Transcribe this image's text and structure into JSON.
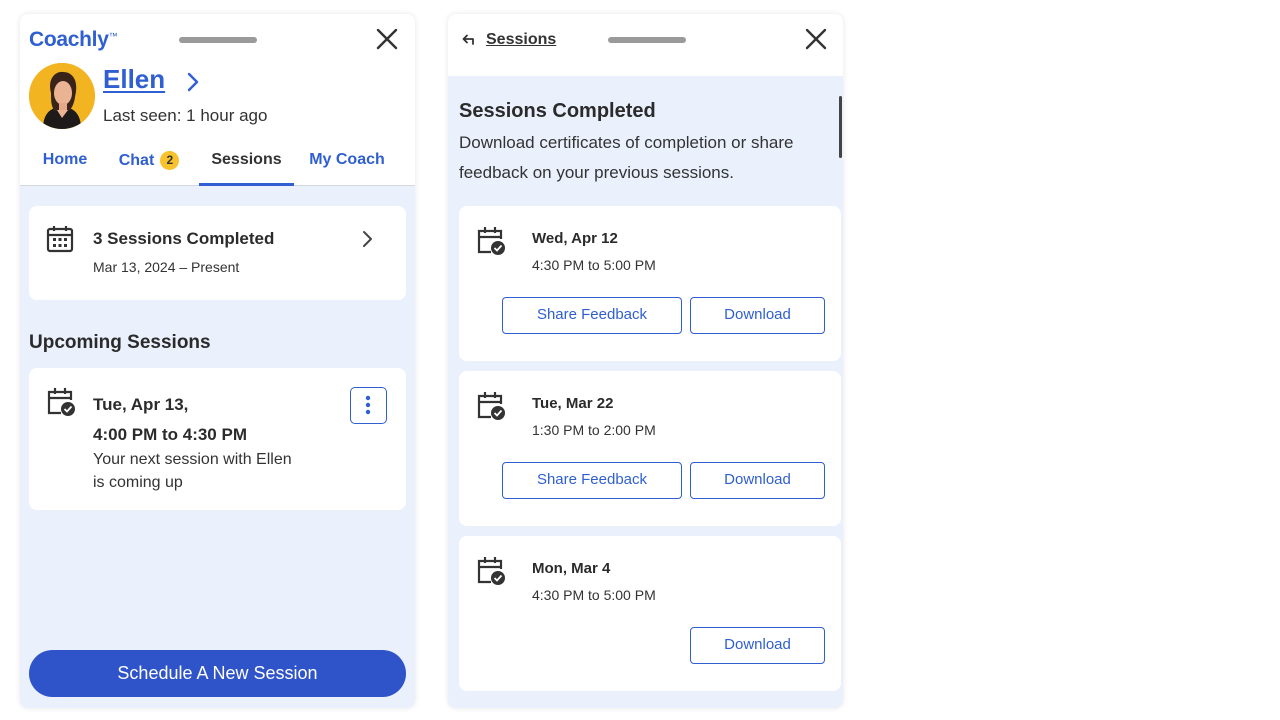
{
  "left_panel": {
    "logo": "Coachly",
    "logo_mark": "™",
    "coach": {
      "name": "Ellen",
      "last_seen": "Last seen: 1 hour ago"
    },
    "tabs": [
      {
        "label": "Home",
        "active": false
      },
      {
        "label": "Chat",
        "active": false,
        "badge": "2"
      },
      {
        "label": "Sessions",
        "active": true
      },
      {
        "label": "My Coach",
        "active": false
      }
    ],
    "summary": {
      "title": "3 Sessions Completed",
      "range": "Mar 13, 2024 – Present"
    },
    "upcoming": {
      "section_title": "Upcoming Sessions",
      "date_line": "Tue, Apr 13,",
      "time_line": "4:00 PM to 4:30 PM",
      "description": "Your next session with Ellen is coming up"
    },
    "schedule_button": "Schedule A New Session"
  },
  "right_panel": {
    "back_label": "Sessions",
    "title": "Sessions Completed",
    "description": "Download certificates of completion or share feedback on your previous sessions.",
    "sessions": [
      {
        "date": "Wed, Apr 12",
        "time": "4:30 PM to 5:00 PM",
        "feedback_label": "Share Feedback",
        "download_label": "Download"
      },
      {
        "date": "Tue, Mar 22",
        "time": "1:30 PM to 2:00 PM",
        "feedback_label": "Share Feedback",
        "download_label": "Download"
      },
      {
        "date": "Mon, Mar 4",
        "time": "4:30 PM to 5:00 PM",
        "download_label": "Download"
      }
    ]
  },
  "colors": {
    "brand_blue": "#2f5fd0",
    "primary_button": "#2f53c9",
    "panel_background": "#eaf1fd",
    "badge_yellow": "#f7c22d",
    "avatar_background": "#f2b521"
  },
  "icons": [
    "close-icon",
    "chevron-right-icon",
    "calendar-icon",
    "calendar-check-icon",
    "more-vertical-icon",
    "back-arrow-icon"
  ]
}
